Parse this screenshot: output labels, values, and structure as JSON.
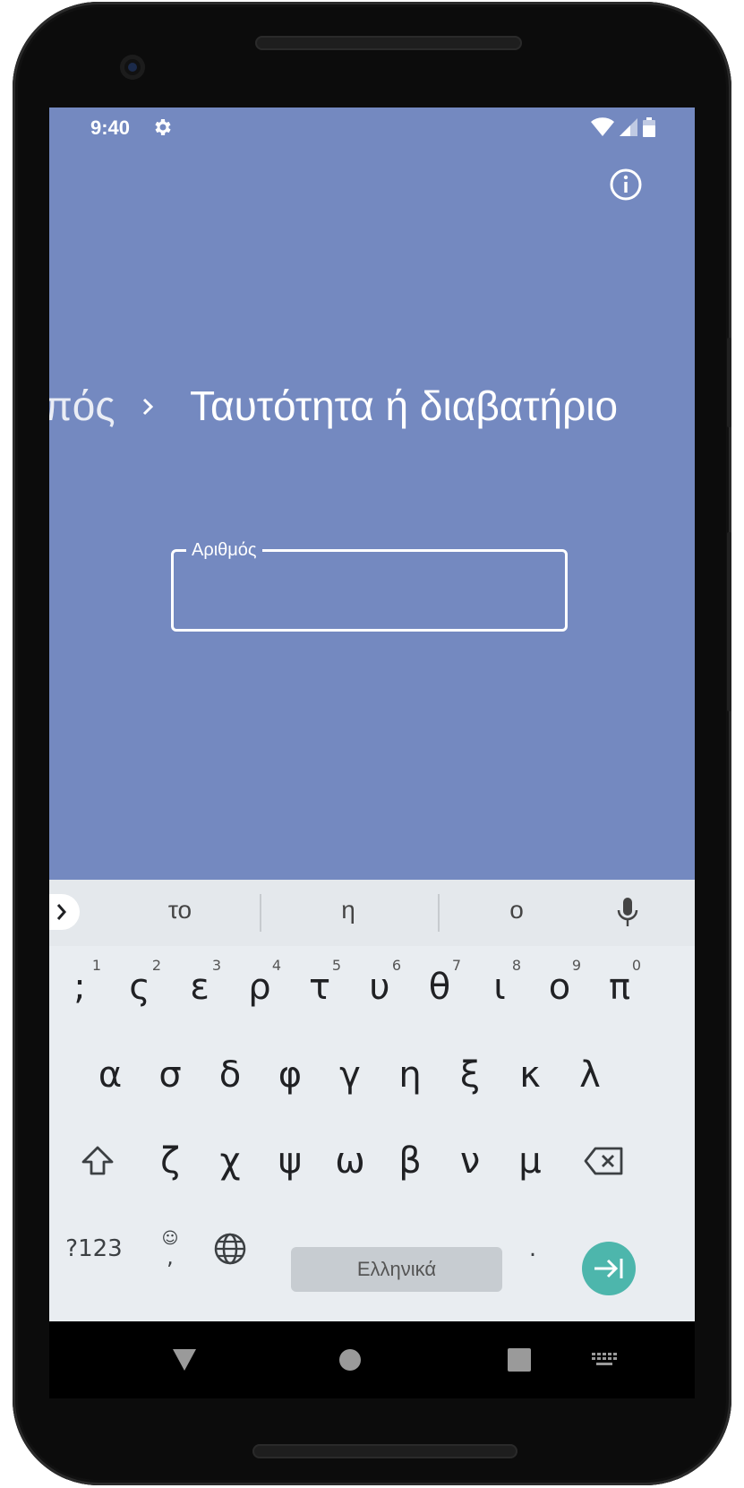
{
  "status_bar": {
    "time": "9:40"
  },
  "breadcrumb": {
    "previous": "πός",
    "separator": "›",
    "current": "Ταυτότητα ή διαβατήριο"
  },
  "number_field": {
    "label": "Αριθμός",
    "value": "",
    "placeholder": ""
  },
  "keyboard": {
    "suggestions": [
      "το",
      "η",
      "ο"
    ],
    "row1": [
      {
        "key": ";",
        "hint": "1"
      },
      {
        "key": "ς",
        "hint": "2"
      },
      {
        "key": "ε",
        "hint": "3"
      },
      {
        "key": "ρ",
        "hint": "4"
      },
      {
        "key": "τ",
        "hint": "5"
      },
      {
        "key": "υ",
        "hint": "6"
      },
      {
        "key": "θ",
        "hint": "7"
      },
      {
        "key": "ι",
        "hint": "8"
      },
      {
        "key": "ο",
        "hint": "9"
      },
      {
        "key": "π",
        "hint": "0"
      }
    ],
    "row2": [
      "α",
      "σ",
      "δ",
      "φ",
      "γ",
      "η",
      "ξ",
      "κ",
      "λ"
    ],
    "row3": [
      "ζ",
      "χ",
      "ψ",
      "ω",
      "β",
      "ν",
      "μ"
    ],
    "symbols_label": "?123",
    "emoji_comma_label": ",",
    "space_label": "Ελληνικά",
    "period_label": "."
  },
  "icons": {
    "settings": "gear-icon",
    "wifi": "wifi-icon",
    "signal": "signal-icon",
    "battery": "battery-icon",
    "info": "info-icon",
    "mic": "mic-icon",
    "shift": "shift-icon",
    "backspace": "backspace-icon",
    "globe": "globe-icon",
    "enter": "enter-arrow-icon",
    "expand": "chevron-right-icon",
    "nav_back": "nav-back-icon",
    "nav_home": "nav-home-icon",
    "nav_recents": "nav-recents-icon",
    "nav_keyboard": "keyboard-switch-icon"
  },
  "colors": {
    "screen_bg": "#7489c0",
    "keyboard_bg": "#e9edf1",
    "accent": "#4db6ac"
  }
}
